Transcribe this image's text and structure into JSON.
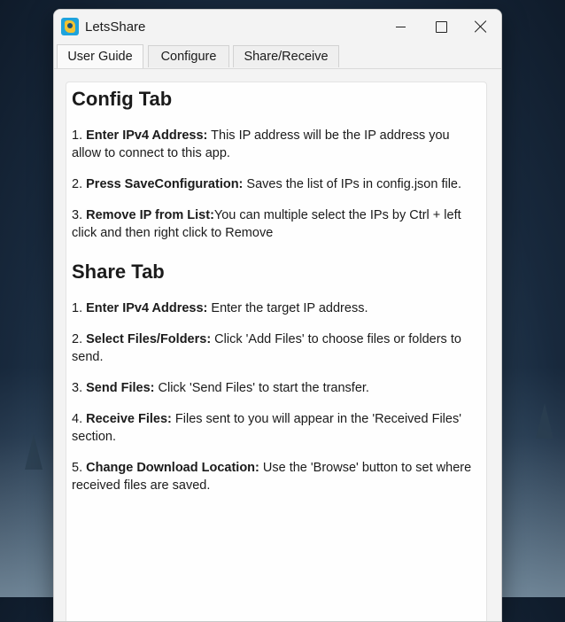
{
  "window": {
    "title": "LetsShare",
    "controls": {
      "minimize": "minimize",
      "maximize": "maximize",
      "close": "close"
    }
  },
  "tabs": [
    {
      "label": "User Guide",
      "active": true
    },
    {
      "label": "Configure",
      "active": false
    },
    {
      "label": "Share/Receive",
      "active": false
    }
  ],
  "guide": {
    "config": {
      "title": "Config Tab",
      "items": [
        {
          "num": "1.",
          "bold": "Enter IPv4 Address:",
          "text": " This IP address will be the IP address you allow to connect to this app."
        },
        {
          "num": "2.",
          "bold": "Press SaveConfiguration:",
          "text": " Saves the list of IPs in config.json file."
        },
        {
          "num": "3.",
          "bold": "Remove IP from List:",
          "text": "You can multiple select the IPs by Ctrl + left click and then right click to Remove"
        }
      ]
    },
    "share": {
      "title": "Share Tab",
      "items": [
        {
          "num": "1.",
          "bold": "Enter IPv4 Address:",
          "text": " Enter the target IP address."
        },
        {
          "num": "2.",
          "bold": "Select Files/Folders:",
          "text": " Click 'Add Files' to choose files or folders to send."
        },
        {
          "num": "3.",
          "bold": "Send Files:",
          "text": " Click 'Send Files' to start the transfer."
        },
        {
          "num": "4.",
          "bold": "Receive Files:",
          "text": " Files sent to you will appear in the 'Received Files' section."
        },
        {
          "num": "5.",
          "bold": "Change Download Location:",
          "text": " Use the 'Browse' button to set where received files are saved."
        }
      ]
    }
  },
  "colors": {
    "window_bg": "#f3f3f3",
    "content_bg": "#fefefe",
    "app_icon": "#1fa3dc"
  }
}
